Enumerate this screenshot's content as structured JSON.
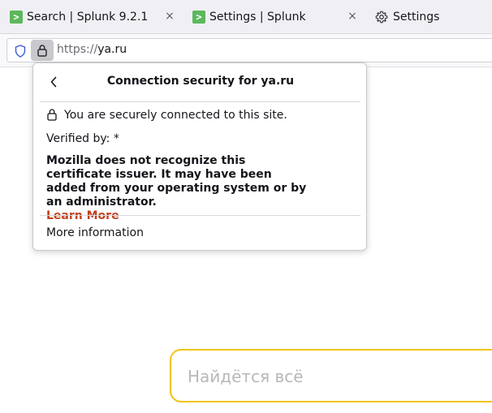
{
  "tabs": [
    {
      "title": "Search | Splunk 9.2.1",
      "favicon": ">",
      "close": "×"
    },
    {
      "title": "Settings | Splunk",
      "favicon": ">",
      "close": "×"
    },
    {
      "title": "Settings",
      "icon": "gear-icon"
    }
  ],
  "urlbar": {
    "scheme": "https://",
    "host": "ya.ru"
  },
  "popup": {
    "title": "Connection security for ya.ru",
    "secure_text": "You are securely connected to this site.",
    "verified_by": "Verified by: *",
    "warning": "Mozilla does not recognize this certificate issuer. It may have been added from your operating system or by an administrator.",
    "learn_more": "Learn More",
    "more_information": "More information"
  },
  "page": {
    "search_placeholder": "Найдётся всё"
  },
  "colors": {
    "favicon_green": "#5cb85c",
    "link_orange": "#c0401c",
    "search_border": "#f1c40f"
  }
}
